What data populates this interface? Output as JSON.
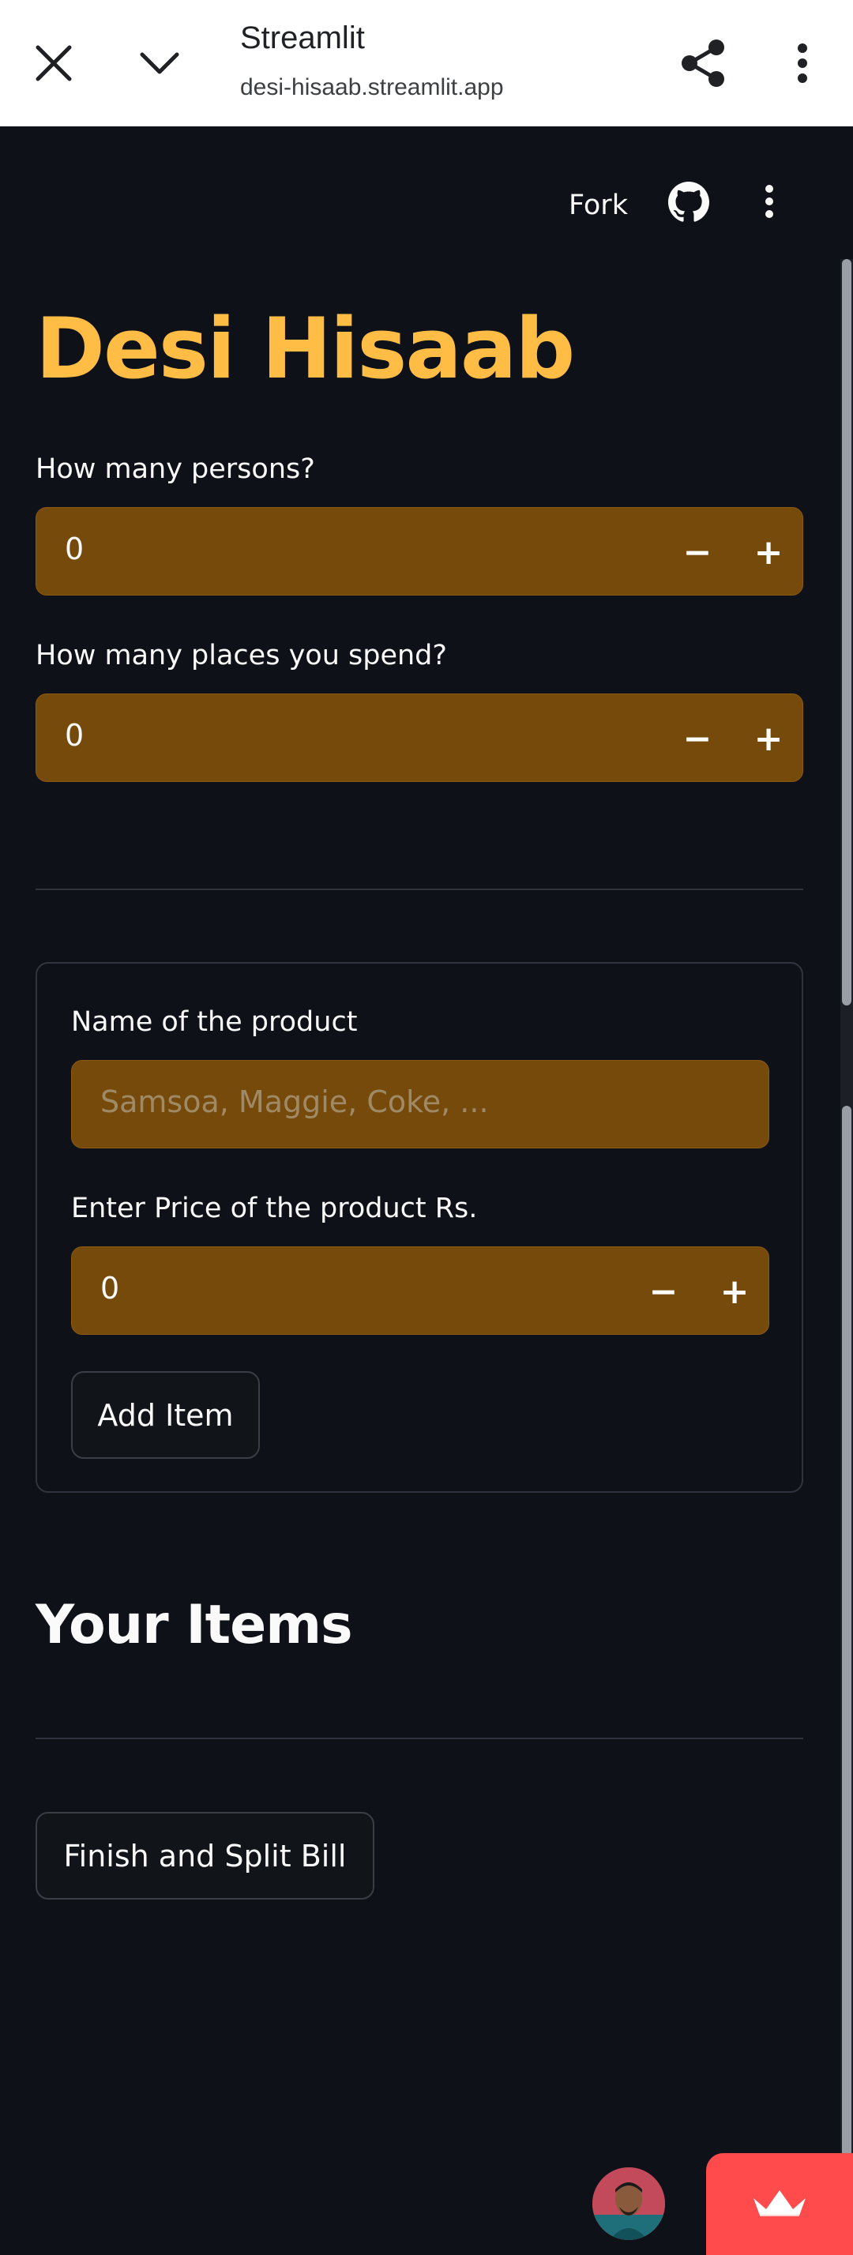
{
  "browser": {
    "title": "Streamlit",
    "url": "desi-hisaab.streamlit.app"
  },
  "toolbar": {
    "fork_label": "Fork"
  },
  "app": {
    "title": "Desi Hisaab",
    "persons": {
      "label": "How many persons?",
      "value": "0",
      "minus": "−",
      "plus": "+"
    },
    "places": {
      "label": "How many places you spend?",
      "value": "0",
      "minus": "−",
      "plus": "+"
    },
    "product_form": {
      "name_label": "Name of the product",
      "name_placeholder": "Samsoa, Maggie, Coke, ...",
      "price_label": "Enter Price of the product Rs.",
      "price_value": "0",
      "price_minus": "−",
      "price_plus": "+",
      "add_button": "Add Item"
    },
    "items_heading": "Your Items",
    "finish_button": "Finish and Split Bill"
  },
  "colors": {
    "background": "#0e1117",
    "accent_title": "#ffbd45",
    "input_bg": "#754a0b",
    "badge": "#ff4b4b"
  },
  "icons": [
    "close-icon",
    "chevron-down-icon",
    "share-icon",
    "more-vert-icon",
    "github-icon",
    "streamlit-crown-icon"
  ]
}
